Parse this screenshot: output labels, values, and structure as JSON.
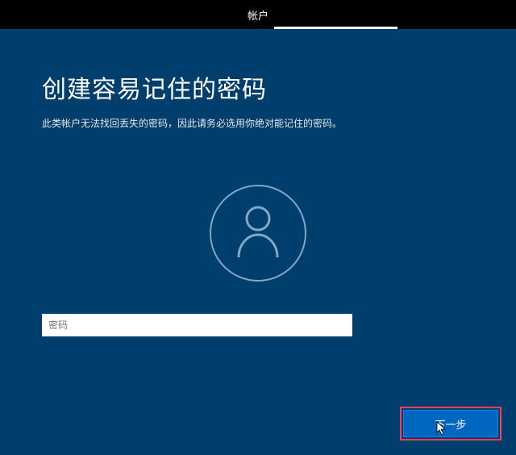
{
  "header": {
    "tab_label": "帐户"
  },
  "main": {
    "title": "创建容易记住的密码",
    "subtitle": "此类帐户无法找回丢失的密码，因此请务必选用你绝对能记住的密码。",
    "password_placeholder": "密码"
  },
  "footer": {
    "next_label": "下一步"
  },
  "colors": {
    "background": "#003e6e",
    "topbar": "#000000",
    "button": "#0067c0",
    "highlight_border": "#ff3b5c"
  }
}
